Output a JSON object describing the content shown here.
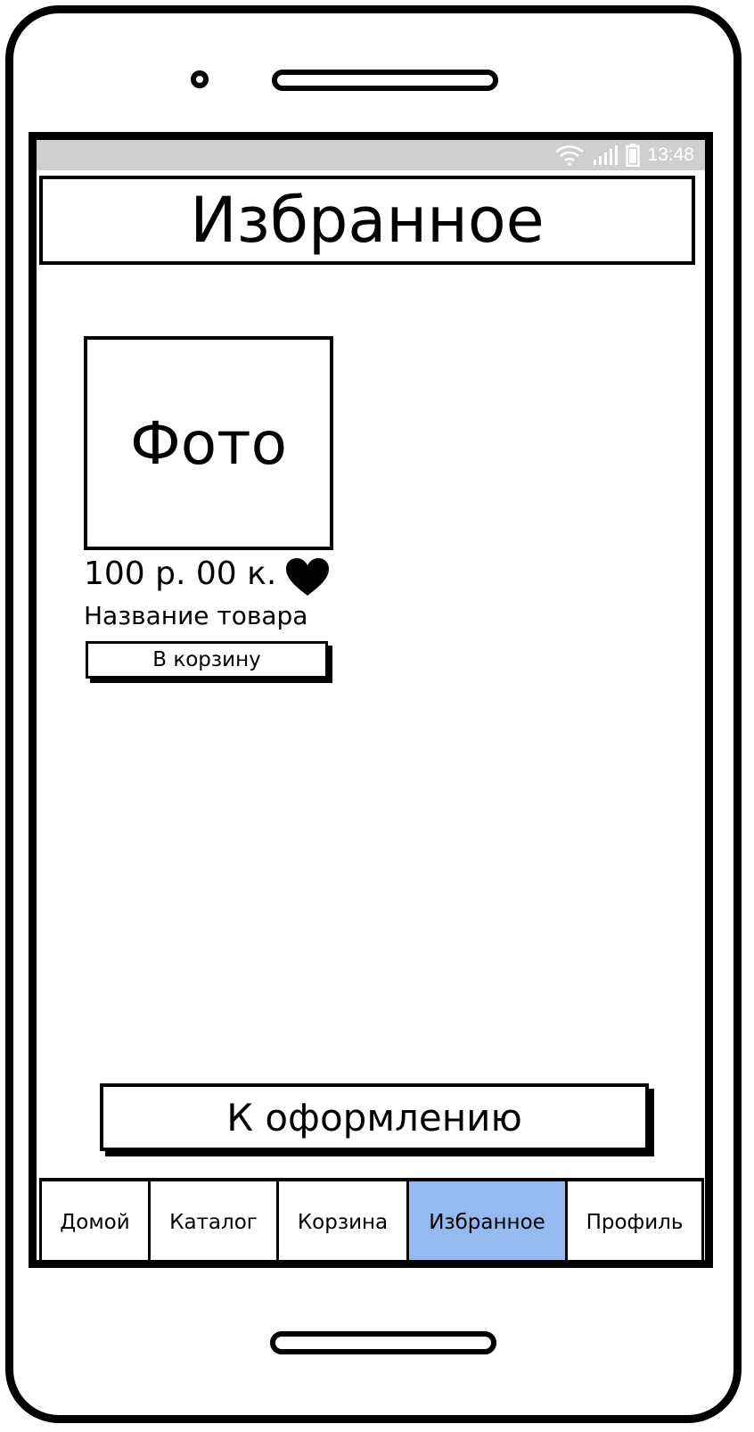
{
  "status_bar": {
    "time": "13:48",
    "icons": [
      "wifi-icon",
      "signal-icon",
      "battery-icon"
    ]
  },
  "header": {
    "title": "Избранное"
  },
  "product": {
    "photo_label": "Фото",
    "price": "100 р. 00 к.",
    "name": "Название товара",
    "add_to_cart": "В корзину",
    "favorite_icon": "heart-icon"
  },
  "checkout": {
    "label": "К оформлению"
  },
  "tabs": [
    {
      "label": "Домой"
    },
    {
      "label": "Каталог"
    },
    {
      "label": "Корзина"
    },
    {
      "label": "Избранное",
      "active": true
    },
    {
      "label": "Профиль"
    }
  ],
  "colors": {
    "active_tab": "#95baf0",
    "status_bar": "#cfcfcf"
  }
}
